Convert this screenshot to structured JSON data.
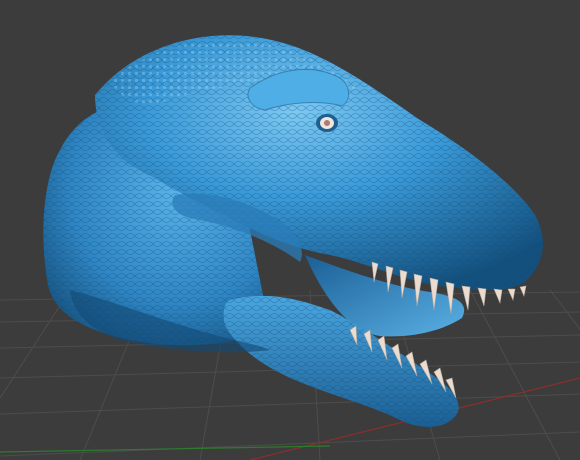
{
  "viewport": {
    "background_color": "#3c3c3c",
    "grid_color": "#4d4d4d",
    "x_axis_color": "#8a2e2e",
    "z_axis_color": "#2e7a2e"
  },
  "model": {
    "subject": "t-rex-head",
    "skin_color": "#3a9ad8",
    "skin_highlight_color": "#7cc8f2",
    "skin_shadow_color": "#13507e",
    "teeth_color": "#eadcd0",
    "eye_color": "#f0e6dc"
  }
}
